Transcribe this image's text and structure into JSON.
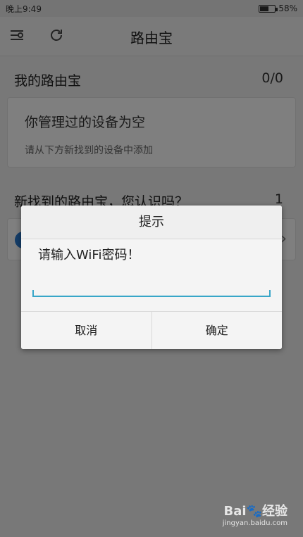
{
  "status_bar": {
    "time": "晚上9:49",
    "battery": "58%",
    "battery_level": 0.58
  },
  "action_bar": {
    "title": "路由宝",
    "menu_icon": "menu-icon",
    "refresh_icon": "refresh-icon"
  },
  "my_routers": {
    "heading": "我的路由宝",
    "count": "0/0",
    "empty_title": "你管理过的设备为空",
    "empty_hint": "请从下方新找到的设备中添加"
  },
  "new_routers": {
    "heading": "新找到的路由宝，您认识吗？",
    "count": "1"
  },
  "dialog": {
    "title": "提示",
    "message": "请输入WiFi密码！",
    "input_value": "",
    "cancel_label": "取消",
    "ok_label": "确定"
  },
  "watermark": {
    "logo": "Bai🐾经验",
    "url": "jingyan.baidu.com"
  },
  "colors": {
    "accent": "#38a6c8",
    "device_dot": "#2a7bd0"
  }
}
